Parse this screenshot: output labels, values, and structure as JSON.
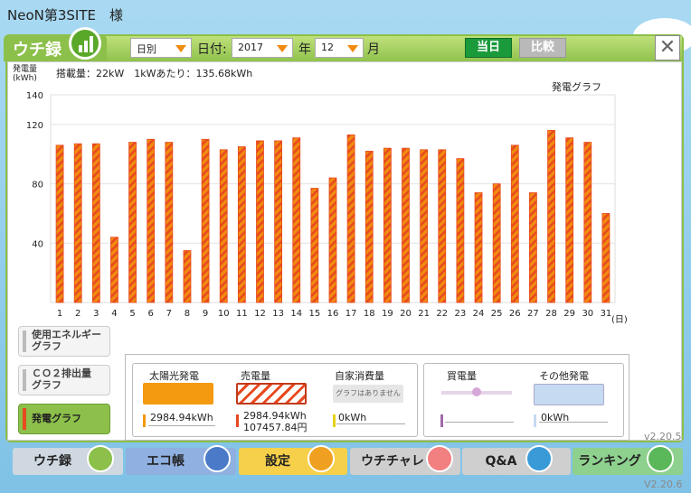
{
  "header": {
    "site_title": "NeoN第3SITE　様",
    "logo_text": "ウチ録"
  },
  "selectors": {
    "mode": "日別",
    "date_label": "日付:",
    "year_value": "2017",
    "year_label": "年",
    "month_value": "12",
    "month_label": "月",
    "today_button": "当日",
    "compare_button": "比較",
    "close_glyph": "✕"
  },
  "chart_info": {
    "y_unit_line1": "発電量",
    "y_unit_line2": "(kWh)",
    "capacity_text": "搭載量：22kW　1kWあたり：135.68kWh",
    "chart_title": "発電グラフ",
    "x_unit": "(日)"
  },
  "chart_data": {
    "type": "bar",
    "title": "発電グラフ",
    "xlabel": "(日)",
    "ylabel": "発電量(kWh)",
    "ylim": [
      0,
      140
    ],
    "yticks": [
      40,
      80,
      120,
      140
    ],
    "categories": [
      "1",
      "2",
      "3",
      "4",
      "5",
      "6",
      "7",
      "8",
      "9",
      "10",
      "11",
      "12",
      "13",
      "14",
      "15",
      "16",
      "17",
      "18",
      "19",
      "20",
      "21",
      "22",
      "23",
      "24",
      "25",
      "26",
      "27",
      "28",
      "29",
      "30",
      "31"
    ],
    "values": [
      106,
      107,
      107,
      44,
      108,
      110,
      108,
      35,
      110,
      103,
      105,
      109,
      109,
      111,
      77,
      84,
      113,
      102,
      104,
      104,
      103,
      103,
      97,
      74,
      80,
      106,
      74,
      116,
      111,
      108,
      60
    ],
    "grid": true,
    "colors": {
      "fill": "#f08a10",
      "hatch": "#e8491f"
    }
  },
  "side_buttons": [
    {
      "label_line1": "使用エネルギー",
      "label_line2": "グラフ",
      "active": false
    },
    {
      "label_line1": "ＣＯ２排出量",
      "label_line2": "グラフ",
      "active": false
    },
    {
      "label_line1": "発電グラフ",
      "label_line2": "",
      "active": true
    }
  ],
  "summary": {
    "solar": {
      "label": "太陽光発電",
      "value": "2984.94kWh"
    },
    "sold": {
      "label": "売電量",
      "value": "2984.94kWh",
      "value2": "107457.84円"
    },
    "self": {
      "label": "自家消費量",
      "placeholder": "グラフはありません",
      "value": "0kWh"
    },
    "bought": {
      "label": "買電量",
      "value": ""
    },
    "other": {
      "label": "その他発電",
      "value": "0kWh"
    }
  },
  "versions": {
    "inner": "v2.20.5",
    "outer": "V2.20.6"
  },
  "nav": [
    {
      "label": "ウチ録",
      "color": "#cfd8e0"
    },
    {
      "label": "エコ帳",
      "color": "#8fb0e0"
    },
    {
      "label": "設定",
      "color": "#f6d04a"
    },
    {
      "label": "ウチチャレ",
      "color": "#cfcfcf"
    },
    {
      "label": "Q&A",
      "color": "#cfcfcf"
    },
    {
      "label": "ランキング",
      "color": "#8ed08e"
    }
  ]
}
